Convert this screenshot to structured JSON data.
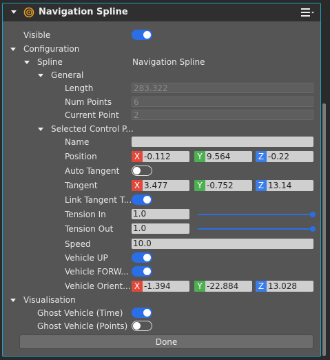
{
  "header": {
    "title": "Navigation Spline",
    "icon": "spline-swirl-icon",
    "menu_icon": "hamburger-menu-icon"
  },
  "colors": {
    "accent": "#2a6ee8",
    "x": "#e0483c",
    "y": "#4caf50",
    "z": "#3b7de8",
    "border": "#1ea3c9"
  },
  "rows": {
    "visible": {
      "label": "Visible",
      "on": true
    },
    "configuration": {
      "label": "Configuration"
    },
    "spline": {
      "label": "Spline",
      "value": "Navigation Spline"
    },
    "general": {
      "label": "General"
    },
    "length": {
      "label": "Length",
      "value": "283.322"
    },
    "num_points": {
      "label": "Num Points",
      "value": "6"
    },
    "current_point": {
      "label": "Current Point",
      "value": "2"
    },
    "selected": {
      "label": "Selected Control P..."
    },
    "name": {
      "label": "Name",
      "value": ""
    },
    "position": {
      "label": "Position",
      "x": "-0.112",
      "y": "9.564",
      "z": "-0.22"
    },
    "auto_tangent": {
      "label": "Auto Tangent",
      "on": false
    },
    "tangent": {
      "label": "Tangent",
      "x": "3.477",
      "y": "-0.752",
      "z": "13.14"
    },
    "link_tangent": {
      "label": "Link Tangent T...",
      "on": true
    },
    "tension_in": {
      "label": "Tension In",
      "value": "1.0",
      "slider": 1.0
    },
    "tension_out": {
      "label": "Tension Out",
      "value": "1.0",
      "slider": 1.0
    },
    "speed": {
      "label": "Speed",
      "value": "10.0"
    },
    "vehicle_up": {
      "label": "Vehicle UP",
      "on": true
    },
    "vehicle_forward": {
      "label": "Vehicle FORW...",
      "on": true
    },
    "vehicle_orient": {
      "label": "Vehicle Orient...",
      "x": "-1.394",
      "y": "-22.884",
      "z": "13.028"
    },
    "visualisation": {
      "label": "Visualisation"
    },
    "ghost_time": {
      "label": "Ghost Vehicle (Time)",
      "on": true
    },
    "ghost_points": {
      "label": "Ghost Vehicle (Points)",
      "on": false
    }
  },
  "axis_labels": {
    "x": "X",
    "y": "Y",
    "z": "Z"
  },
  "done_label": "Done"
}
